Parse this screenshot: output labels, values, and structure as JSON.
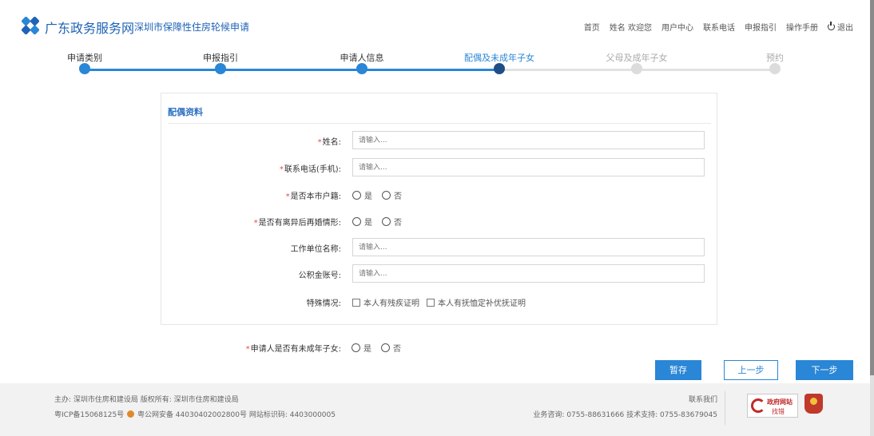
{
  "header": {
    "site_name": "广东政务服务网",
    "sub_name": "深圳市保障性住房轮候申请",
    "nav": [
      "首页",
      "姓名 欢迎您",
      "用户中心",
      "联系电话",
      "申报指引",
      "操作手册"
    ],
    "logout": "退出"
  },
  "steps": [
    {
      "label": "申请类别",
      "state": "done"
    },
    {
      "label": "申报指引",
      "state": "done"
    },
    {
      "label": "申请人信息",
      "state": "done"
    },
    {
      "label": "配偶及未成年子女",
      "state": "current"
    },
    {
      "label": "父母及成年子女",
      "state": "future"
    },
    {
      "label": "预约",
      "state": "future"
    }
  ],
  "form": {
    "section_title": "配偶资料",
    "name": {
      "label": "姓名:",
      "placeholder": "请输入..."
    },
    "phone": {
      "label": "联系电话(手机):",
      "placeholder": "请输入..."
    },
    "local_hukou": {
      "label": "是否本市户籍:",
      "yes": "是",
      "no": "否"
    },
    "remarried": {
      "label": "是否有离异后再婚情形:",
      "yes": "是",
      "no": "否"
    },
    "employer": {
      "label": "工作单位名称:",
      "placeholder": "请输入..."
    },
    "fund_account": {
      "label": "公积金账号:",
      "placeholder": "请输入..."
    },
    "special": {
      "label": "特殊情况:",
      "option1": "本人有残疾证明",
      "option2": "本人有抚恤定补优抚证明"
    }
  },
  "minor_children": {
    "label": "申请人是否有未成年子女:",
    "yes": "是",
    "no": "否"
  },
  "required_mark": "*",
  "buttons": {
    "save": "暂存",
    "prev": "上一步",
    "next": "下一步"
  },
  "footer": {
    "line1": "主办:  深圳市住房和建设局 版权所有:  深圳市住房和建设局",
    "line2_a": "粤ICP备15068125号",
    "line2_b": "粤公网安备 44030402002800号 网站标识码: 4403000005",
    "contact": "联系我们",
    "consult": "业务咨询: 0755-88631666 技术支持: 0755-83679045",
    "badge_line1": "政府网站",
    "badge_line2": "找错"
  },
  "colors": {
    "brand": "#1e63b5",
    "accent": "#2a86d6",
    "required": "#e24b4b"
  }
}
